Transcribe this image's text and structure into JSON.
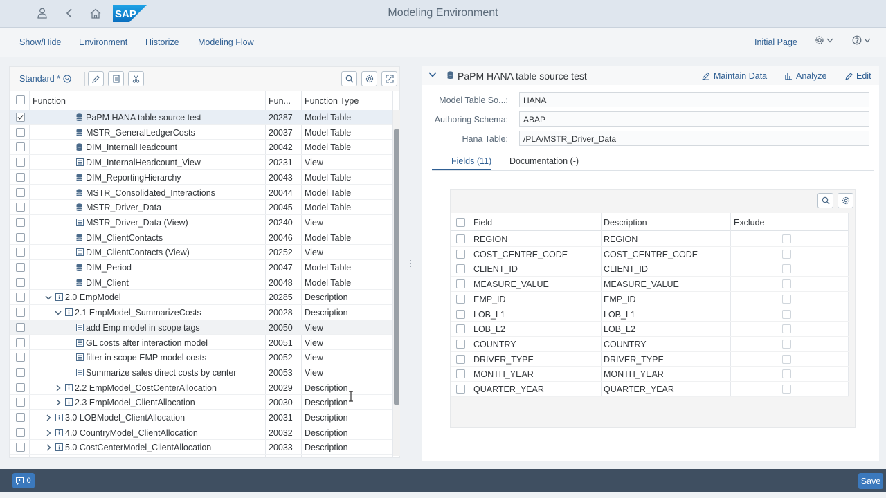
{
  "shell": {
    "title": "Modeling Environment",
    "logo_text": "SAP"
  },
  "menu": {
    "items": [
      "Show/Hide",
      "Environment",
      "Historize",
      "Modeling Flow"
    ],
    "initial_page": "Initial Page"
  },
  "left": {
    "variant": "Standard *",
    "columns": [
      "Function",
      "Fun...",
      "Function Type"
    ],
    "rows": [
      {
        "name": "PaPM HANA table source test",
        "id": "20287",
        "type": "Model Table",
        "icon": "database-icon",
        "checked": true
      },
      {
        "name": "MSTR_GeneralLedgerCosts",
        "id": "20037",
        "type": "Model Table",
        "icon": "database-icon"
      },
      {
        "name": "DIM_InternalHeadcount",
        "id": "20042",
        "type": "Model Table",
        "icon": "database-icon"
      },
      {
        "name": "DIM_InternalHeadcount_View",
        "id": "20231",
        "type": "View",
        "icon": "view-icon"
      },
      {
        "name": "DIM_ReportingHierarchy",
        "id": "20043",
        "type": "Model Table",
        "icon": "database-icon"
      },
      {
        "name": "MSTR_Consolidated_Interactions",
        "id": "20044",
        "type": "Model Table",
        "icon": "database-icon"
      },
      {
        "name": "MSTR_Driver_Data",
        "id": "20045",
        "type": "Model Table",
        "icon": "database-icon"
      },
      {
        "name": "MSTR_Driver_Data (View)",
        "id": "20240",
        "type": "View",
        "icon": "view-icon"
      },
      {
        "name": "DIM_ClientContacts",
        "id": "20046",
        "type": "Model Table",
        "icon": "database-icon"
      },
      {
        "name": "DIM_ClientContacts (View)",
        "id": "20252",
        "type": "View",
        "icon": "view-icon"
      },
      {
        "name": "DIM_Period",
        "id": "20047",
        "type": "Model Table",
        "icon": "database-icon"
      },
      {
        "name": "DIM_Client",
        "id": "20048",
        "type": "Model Table",
        "icon": "database-icon"
      },
      {
        "name": "2.0 EmpModel",
        "id": "20285",
        "type": "Description",
        "icon": "info-icon",
        "toggle": "expanded"
      },
      {
        "name": "2.1 EmpModel_SummarizeCosts",
        "id": "20028",
        "type": "Description",
        "icon": "info-icon",
        "toggle": "expanded"
      },
      {
        "name": "add Emp model in scope tags",
        "id": "20050",
        "type": "View",
        "icon": "view-icon",
        "hover": true
      },
      {
        "name": "GL costs after interaction model",
        "id": "20051",
        "type": "View",
        "icon": "view-icon"
      },
      {
        "name": "filter in scope EMP model costs",
        "id": "20052",
        "type": "View",
        "icon": "view-icon"
      },
      {
        "name": "Summarize sales direct costs by center",
        "id": "20053",
        "type": "View",
        "icon": "view-icon"
      },
      {
        "name": "2.2 EmpModel_CostCenterAllocation",
        "id": "20029",
        "type": "Description",
        "icon": "info-icon",
        "toggle": "collapsed"
      },
      {
        "name": "2.3 EmpModel_ClientAllocation",
        "id": "20030",
        "type": "Description",
        "icon": "info-icon",
        "toggle": "collapsed"
      },
      {
        "name": "3.0 LOBModel_ClientAllocation",
        "id": "20031",
        "type": "Description",
        "icon": "info-icon",
        "toggle": "collapsed"
      },
      {
        "name": "4.0 CountryModel_ClientAllocation",
        "id": "20032",
        "type": "Description",
        "icon": "info-icon",
        "toggle": "collapsed"
      },
      {
        "name": "5.0 CostCenterModel_ClientAllocation",
        "id": "20033",
        "type": "Description",
        "icon": "info-icon",
        "toggle": "collapsed"
      }
    ]
  },
  "right": {
    "title": "PaPM HANA table source test",
    "actions": [
      "Maintain Data",
      "Analyze",
      "Edit"
    ],
    "form": [
      {
        "label": "Model Table So...:",
        "value": "HANA"
      },
      {
        "label": "Authoring Schema:",
        "value": "ABAP"
      },
      {
        "label": "Hana Table:",
        "value": "/PLA/MSTR_Driver_Data"
      }
    ],
    "tabs": [
      "Fields (11)",
      "Documentation (-)"
    ],
    "fields_columns": [
      "Field",
      "Description",
      "Exclude"
    ],
    "fields": [
      {
        "field": "REGION",
        "description": "REGION"
      },
      {
        "field": "COST_CENTRE_CODE",
        "description": "COST_CENTRE_CODE"
      },
      {
        "field": "CLIENT_ID",
        "description": "CLIENT_ID"
      },
      {
        "field": "MEASURE_VALUE",
        "description": "MEASURE_VALUE"
      },
      {
        "field": "EMP_ID",
        "description": "EMP_ID"
      },
      {
        "field": "LOB_L1",
        "description": "LOB_L1"
      },
      {
        "field": "LOB_L2",
        "description": "LOB_L2"
      },
      {
        "field": "COUNTRY",
        "description": "COUNTRY"
      },
      {
        "field": "DRIVER_TYPE",
        "description": "DRIVER_TYPE"
      },
      {
        "field": "MONTH_YEAR",
        "description": "MONTH_YEAR"
      },
      {
        "field": "QUARTER_YEAR",
        "description": "QUARTER_YEAR"
      }
    ]
  },
  "footer": {
    "messages_count": "0",
    "save_label": "Save"
  }
}
